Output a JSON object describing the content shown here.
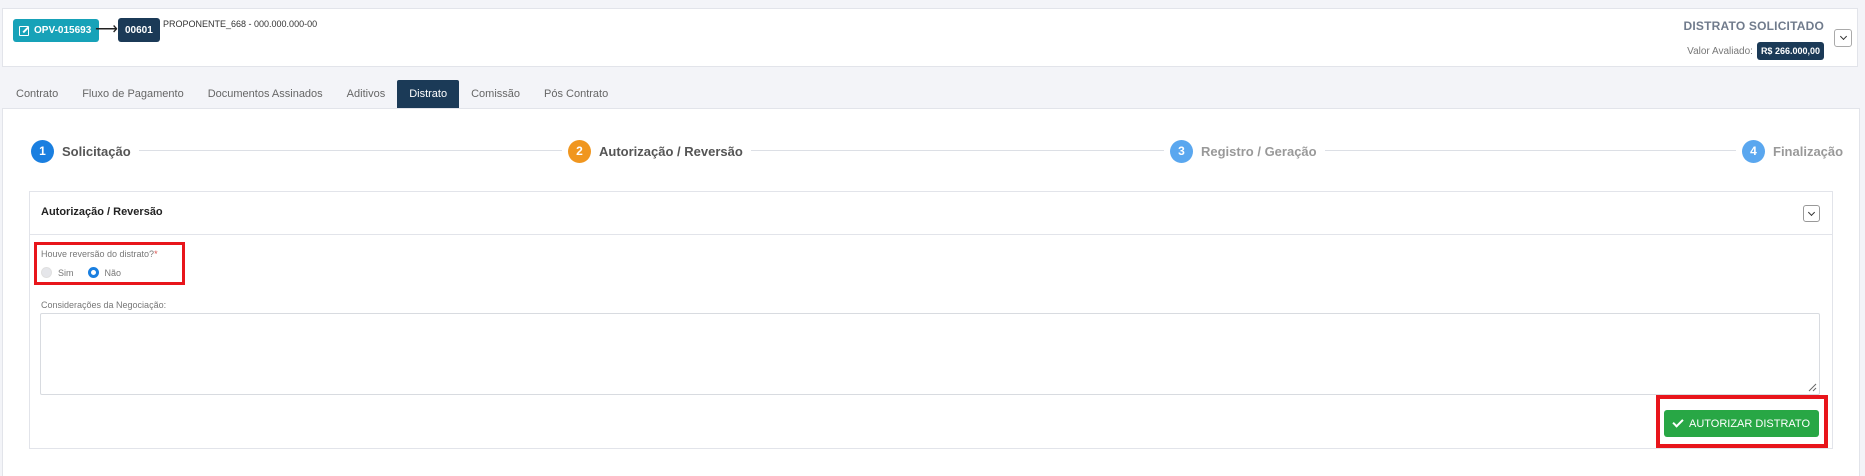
{
  "header": {
    "opv_code": "OPV-015693",
    "unit_code": "00601",
    "proponent": "PROPONENTE_668 - 000.000.000-00",
    "status": "DISTRATO SOLICITADO",
    "valor_label": "Valor Avaliado:",
    "valor_value": "R$ 266.000,00",
    "icons": [
      "edit-icon",
      "arrow-right-icon",
      "chevron-down-icon"
    ]
  },
  "tabs": [
    {
      "label": "Contrato",
      "active": false
    },
    {
      "label": "Fluxo de Pagamento",
      "active": false
    },
    {
      "label": "Documentos Assinados",
      "active": false
    },
    {
      "label": "Aditivos",
      "active": false
    },
    {
      "label": "Distrato",
      "active": true
    },
    {
      "label": "Comissão",
      "active": false
    },
    {
      "label": "Pós Contrato",
      "active": false
    }
  ],
  "stepper": {
    "steps": [
      {
        "number": "1",
        "label": "Solicitação",
        "color": "#1a7fe0",
        "label_color": "#555"
      },
      {
        "number": "2",
        "label": "Autorização / Reversão",
        "color": "#f0961f",
        "label_color": "#555"
      },
      {
        "number": "3",
        "label": "Registro / Geração",
        "color": "#5aa7ef",
        "label_color": "#999"
      },
      {
        "number": "4",
        "label": "Finalização",
        "color": "#5aa7ef",
        "label_color": "#999"
      }
    ]
  },
  "panel": {
    "title": "Autorização / Reversão",
    "question_label": "Houve reversão do distrato?",
    "required_mark": "*",
    "options": [
      {
        "label": "Sim",
        "selected": false
      },
      {
        "label": "Não",
        "selected": true
      }
    ],
    "considerations_label": "Considerações da Negociação:",
    "considerations_value": "",
    "submit_label": "AUTORIZAR DISTRATO"
  },
  "colors": {
    "primary_dark": "#1b3a57",
    "teal": "#17a2b8",
    "success": "#28a745",
    "highlight": "#e8151b"
  }
}
